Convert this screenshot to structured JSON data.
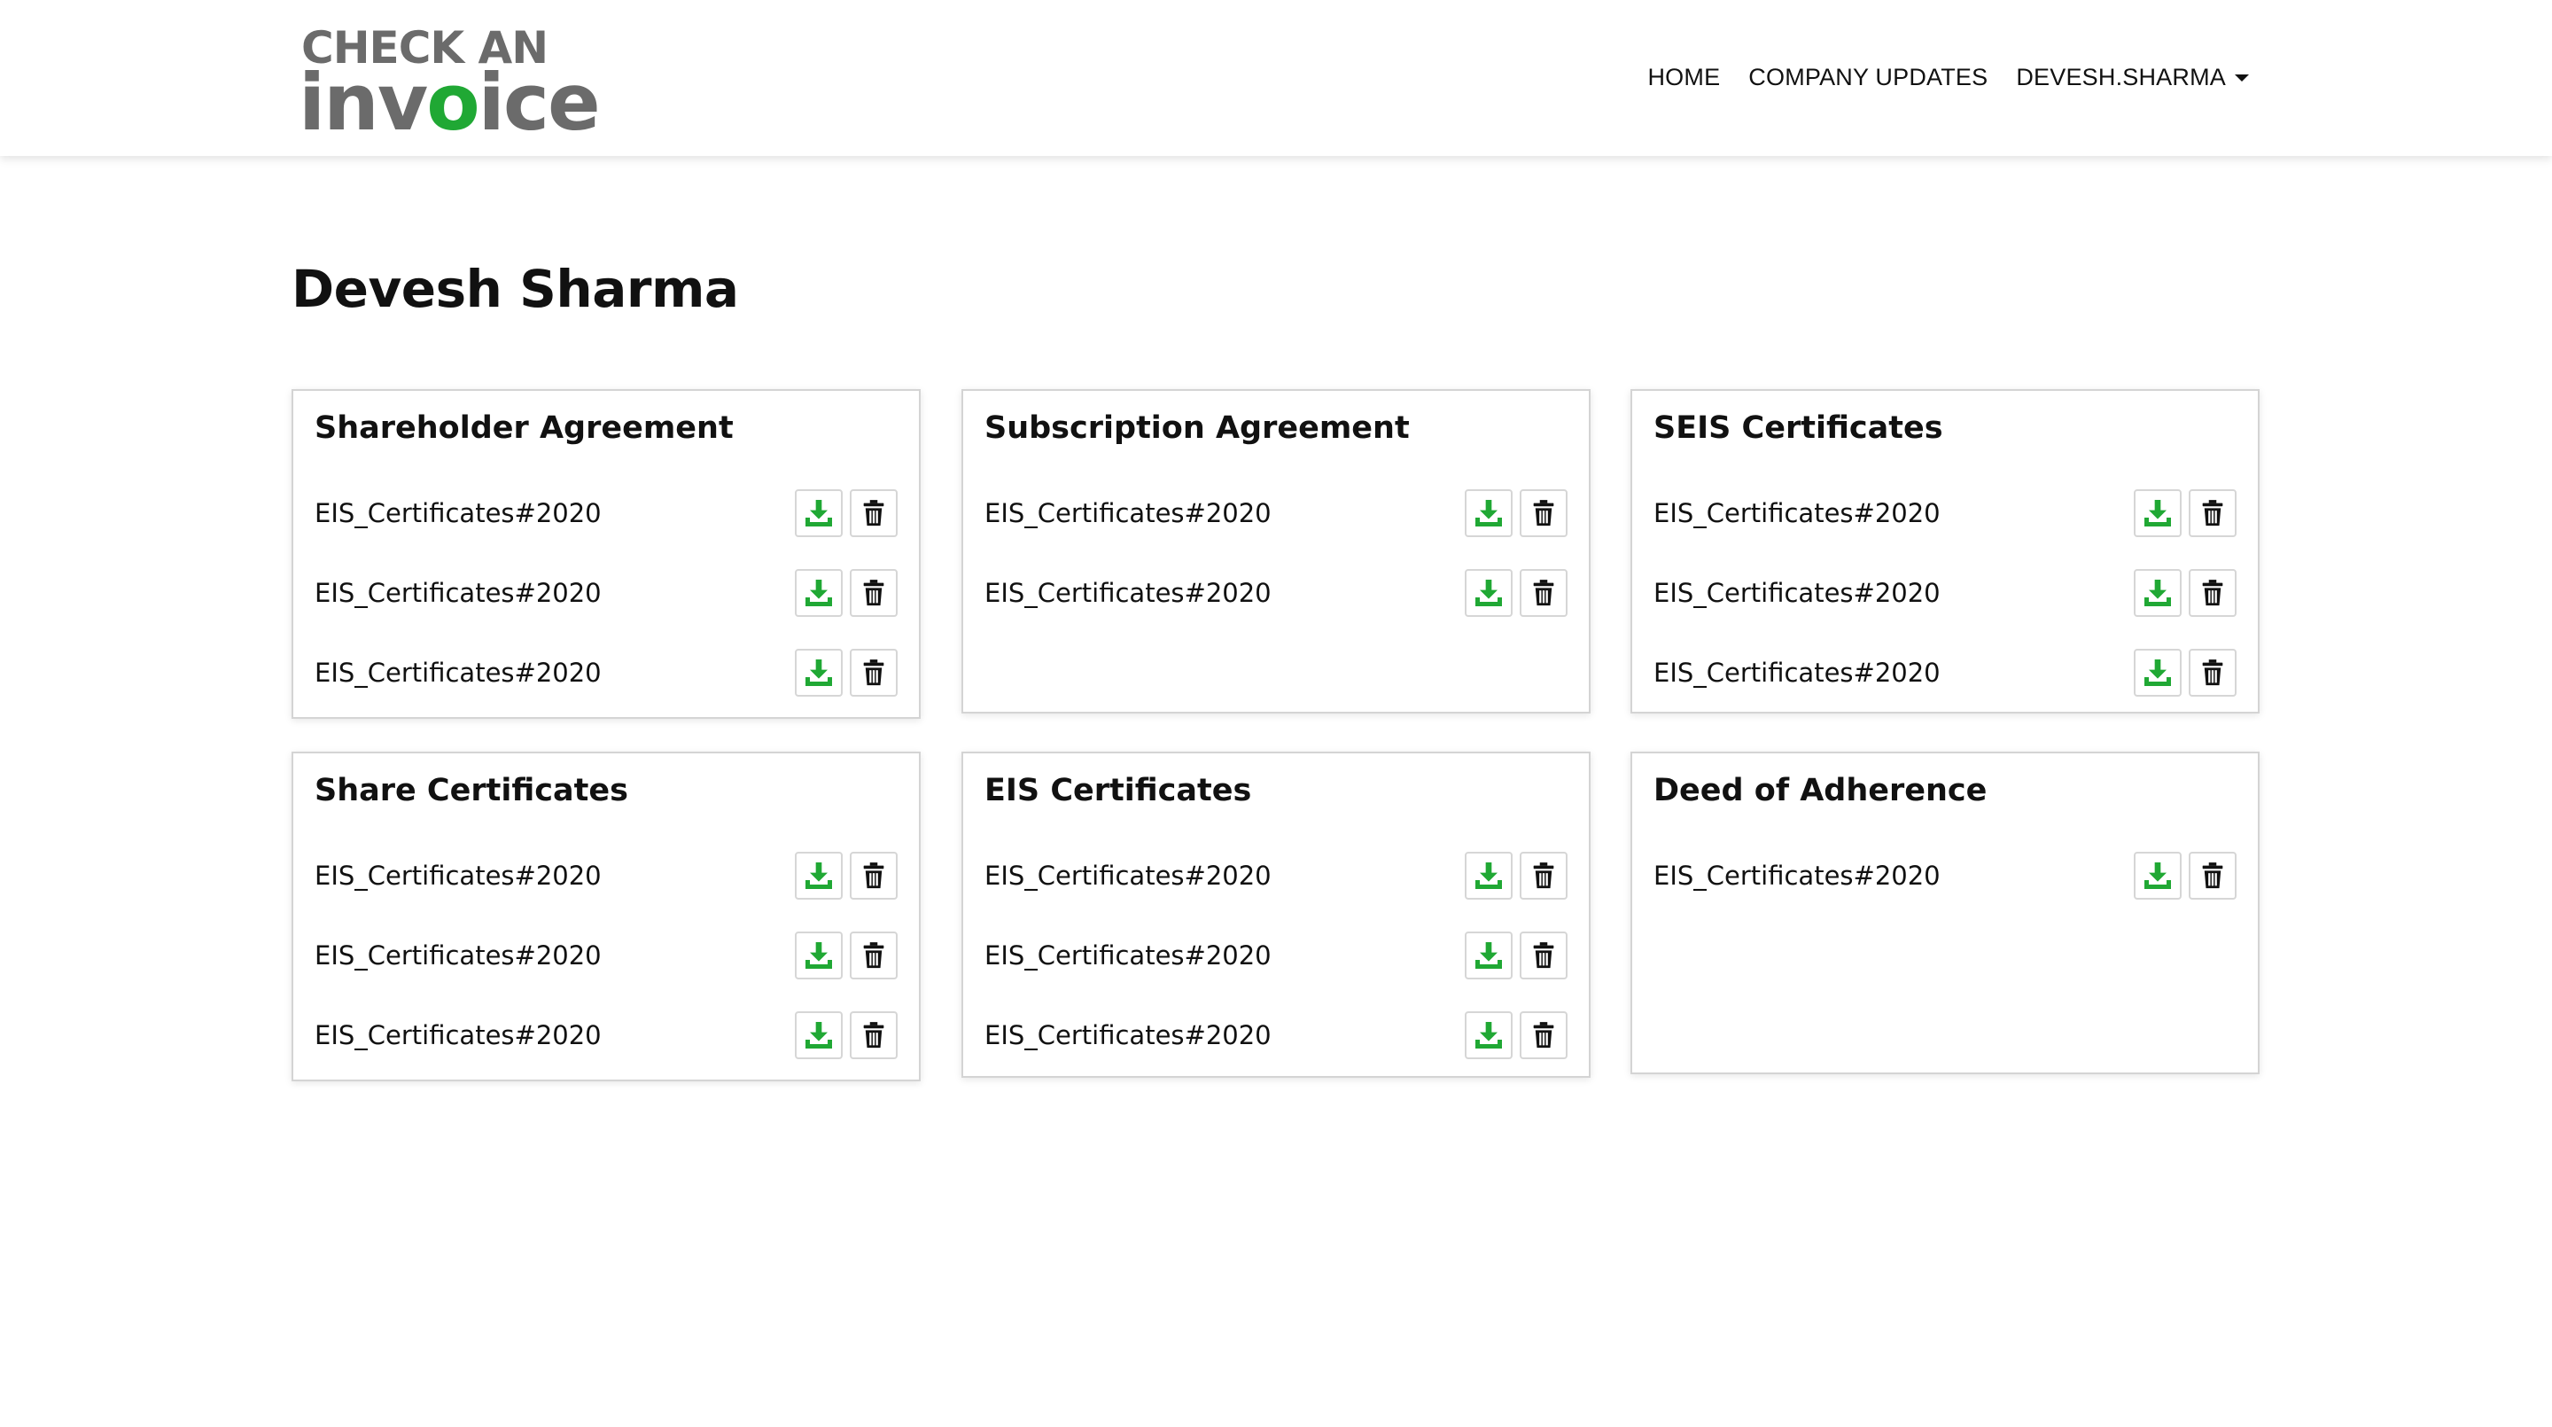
{
  "brand": {
    "line1": "CHECK AN",
    "line2_a": "inv",
    "line2_b": "o",
    "line2_c": "ice"
  },
  "nav": {
    "home": "HOME",
    "company_updates": "COMPANY UPDATES",
    "user": "DEVESH.SHARMA"
  },
  "page_title": "Devesh Sharma",
  "colors": {
    "accent_green": "#20a834",
    "logo_gray": "#6b6b6b"
  },
  "icons": {
    "download": "download-icon",
    "delete": "trash-icon"
  },
  "cards": [
    {
      "title": "Shareholder Agreement",
      "files": [
        "EIS_Certificates#2020",
        "EIS_Certificates#2020",
        "EIS_Certificates#2020"
      ]
    },
    {
      "title": "Subscription Agreement",
      "files": [
        "EIS_Certificates#2020",
        "EIS_Certificates#2020"
      ]
    },
    {
      "title": "SEIS Certificates",
      "files": [
        "EIS_Certificates#2020",
        "EIS_Certificates#2020",
        "EIS_Certificates#2020"
      ]
    },
    {
      "title": "Share Certificates",
      "files": [
        "EIS_Certificates#2020",
        "EIS_Certificates#2020",
        "EIS_Certificates#2020"
      ]
    },
    {
      "title": "EIS Certificates",
      "files": [
        "EIS_Certificates#2020",
        "EIS_Certificates#2020",
        "EIS_Certificates#2020"
      ]
    },
    {
      "title": "Deed of Adherence",
      "files": [
        "EIS_Certificates#2020"
      ]
    }
  ]
}
